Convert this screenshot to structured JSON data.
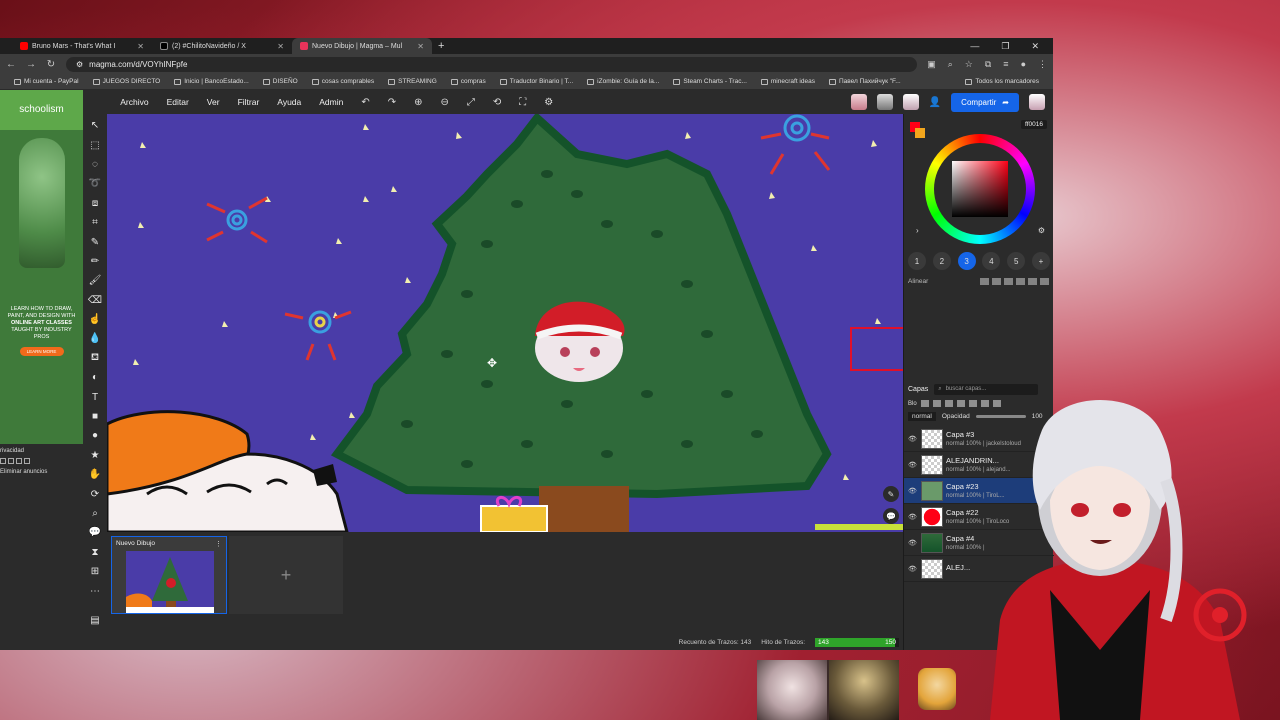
{
  "browser": {
    "tabs": [
      {
        "label": "Bruno Mars - That's What I",
        "color": "#ff0000"
      },
      {
        "label": "(2) #ChilitoNavideño / X",
        "color": "#000000"
      },
      {
        "label": "Nuevo Dibujo | Magma – Mul",
        "color": "#e8335a"
      }
    ],
    "url": "magma.com/d/VOYhINFpfe",
    "bookmarks": [
      "Mi cuenta - PayPal",
      "JUEGOS DIRECTO",
      "Inicio | BancoEstado...",
      "DISEÑO",
      "cosas comprables",
      "STREAMING",
      "compras",
      "Traductor Binario | T...",
      "iZombie: Guía de la...",
      "Steam Charts - Trac...",
      "minecraft ideas",
      "Павел Пахийчук \"F..."
    ],
    "all_bookmarks": "Todos los marcadores"
  },
  "ad": {
    "brand": "schoolism",
    "text1": "LEARN HOW TO DRAW, PAINT, AND DESIGN WITH",
    "text2": "ONLINE ART CLASSES",
    "text3": "TAUGHT BY INDUSTRY PROS",
    "cta": "LEARN MORE",
    "privacy": "rivacidad",
    "remove_ads": "Eliminar anuncios"
  },
  "menu": {
    "items": [
      "Archivo",
      "Editar",
      "Ver",
      "Filtrar",
      "Ayuda",
      "Admin"
    ],
    "share": "Compartir"
  },
  "color": {
    "hex": "ff0016",
    "primary": "#ff0016",
    "secondary": "#f2a61d"
  },
  "brushes": [
    "1",
    "2",
    "3",
    "4",
    "5",
    "+"
  ],
  "align_label": "Alinear",
  "layers_panel": {
    "title": "Capas",
    "search_placeholder": "buscar capas...",
    "lock_label": "Blo",
    "blend": "normal",
    "opacity_label": "Opacidad",
    "opacity_value": "100",
    "layers": [
      {
        "name": "Capa #3",
        "meta": "normal 100% | jackelstoloud"
      },
      {
        "name": "ALEJANDRIN...",
        "meta": "normal 100% | alejand..."
      },
      {
        "name": "Capa #23",
        "meta": "normal 100% | TiroL..."
      },
      {
        "name": "Capa #22",
        "meta": "normal 100% | TiroLoco"
      },
      {
        "name": "Capa #4",
        "meta": "normal 100% |"
      },
      {
        "name": "ALEJ...",
        "meta": ""
      }
    ]
  },
  "document": {
    "title": "Nuevo Dibujo",
    "add_label": "+"
  },
  "status": {
    "count_label": "Recuento de Trazos: 143",
    "hit_label": "Hito de Trazos:",
    "current": "143",
    "goal": "150",
    "progress": 0.953
  }
}
